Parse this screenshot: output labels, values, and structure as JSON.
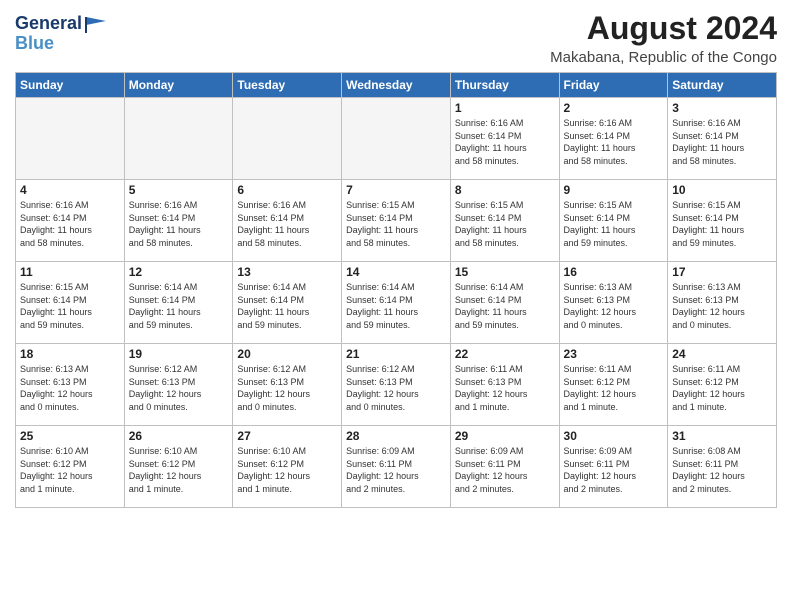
{
  "logo": {
    "line1": "General",
    "line2": "Blue"
  },
  "title": "August 2024",
  "subtitle": "Makabana, Republic of the Congo",
  "days_of_week": [
    "Sunday",
    "Monday",
    "Tuesday",
    "Wednesday",
    "Thursday",
    "Friday",
    "Saturday"
  ],
  "weeks": [
    [
      {
        "day": "",
        "info": ""
      },
      {
        "day": "",
        "info": ""
      },
      {
        "day": "",
        "info": ""
      },
      {
        "day": "",
        "info": ""
      },
      {
        "day": "1",
        "info": "Sunrise: 6:16 AM\nSunset: 6:14 PM\nDaylight: 11 hours\nand 58 minutes."
      },
      {
        "day": "2",
        "info": "Sunrise: 6:16 AM\nSunset: 6:14 PM\nDaylight: 11 hours\nand 58 minutes."
      },
      {
        "day": "3",
        "info": "Sunrise: 6:16 AM\nSunset: 6:14 PM\nDaylight: 11 hours\nand 58 minutes."
      }
    ],
    [
      {
        "day": "4",
        "info": "Sunrise: 6:16 AM\nSunset: 6:14 PM\nDaylight: 11 hours\nand 58 minutes."
      },
      {
        "day": "5",
        "info": "Sunrise: 6:16 AM\nSunset: 6:14 PM\nDaylight: 11 hours\nand 58 minutes."
      },
      {
        "day": "6",
        "info": "Sunrise: 6:16 AM\nSunset: 6:14 PM\nDaylight: 11 hours\nand 58 minutes."
      },
      {
        "day": "7",
        "info": "Sunrise: 6:15 AM\nSunset: 6:14 PM\nDaylight: 11 hours\nand 58 minutes."
      },
      {
        "day": "8",
        "info": "Sunrise: 6:15 AM\nSunset: 6:14 PM\nDaylight: 11 hours\nand 58 minutes."
      },
      {
        "day": "9",
        "info": "Sunrise: 6:15 AM\nSunset: 6:14 PM\nDaylight: 11 hours\nand 59 minutes."
      },
      {
        "day": "10",
        "info": "Sunrise: 6:15 AM\nSunset: 6:14 PM\nDaylight: 11 hours\nand 59 minutes."
      }
    ],
    [
      {
        "day": "11",
        "info": "Sunrise: 6:15 AM\nSunset: 6:14 PM\nDaylight: 11 hours\nand 59 minutes."
      },
      {
        "day": "12",
        "info": "Sunrise: 6:14 AM\nSunset: 6:14 PM\nDaylight: 11 hours\nand 59 minutes."
      },
      {
        "day": "13",
        "info": "Sunrise: 6:14 AM\nSunset: 6:14 PM\nDaylight: 11 hours\nand 59 minutes."
      },
      {
        "day": "14",
        "info": "Sunrise: 6:14 AM\nSunset: 6:14 PM\nDaylight: 11 hours\nand 59 minutes."
      },
      {
        "day": "15",
        "info": "Sunrise: 6:14 AM\nSunset: 6:14 PM\nDaylight: 11 hours\nand 59 minutes."
      },
      {
        "day": "16",
        "info": "Sunrise: 6:13 AM\nSunset: 6:13 PM\nDaylight: 12 hours\nand 0 minutes."
      },
      {
        "day": "17",
        "info": "Sunrise: 6:13 AM\nSunset: 6:13 PM\nDaylight: 12 hours\nand 0 minutes."
      }
    ],
    [
      {
        "day": "18",
        "info": "Sunrise: 6:13 AM\nSunset: 6:13 PM\nDaylight: 12 hours\nand 0 minutes."
      },
      {
        "day": "19",
        "info": "Sunrise: 6:12 AM\nSunset: 6:13 PM\nDaylight: 12 hours\nand 0 minutes."
      },
      {
        "day": "20",
        "info": "Sunrise: 6:12 AM\nSunset: 6:13 PM\nDaylight: 12 hours\nand 0 minutes."
      },
      {
        "day": "21",
        "info": "Sunrise: 6:12 AM\nSunset: 6:13 PM\nDaylight: 12 hours\nand 0 minutes."
      },
      {
        "day": "22",
        "info": "Sunrise: 6:11 AM\nSunset: 6:13 PM\nDaylight: 12 hours\nand 1 minute."
      },
      {
        "day": "23",
        "info": "Sunrise: 6:11 AM\nSunset: 6:12 PM\nDaylight: 12 hours\nand 1 minute."
      },
      {
        "day": "24",
        "info": "Sunrise: 6:11 AM\nSunset: 6:12 PM\nDaylight: 12 hours\nand 1 minute."
      }
    ],
    [
      {
        "day": "25",
        "info": "Sunrise: 6:10 AM\nSunset: 6:12 PM\nDaylight: 12 hours\nand 1 minute."
      },
      {
        "day": "26",
        "info": "Sunrise: 6:10 AM\nSunset: 6:12 PM\nDaylight: 12 hours\nand 1 minute."
      },
      {
        "day": "27",
        "info": "Sunrise: 6:10 AM\nSunset: 6:12 PM\nDaylight: 12 hours\nand 1 minute."
      },
      {
        "day": "28",
        "info": "Sunrise: 6:09 AM\nSunset: 6:11 PM\nDaylight: 12 hours\nand 2 minutes."
      },
      {
        "day": "29",
        "info": "Sunrise: 6:09 AM\nSunset: 6:11 PM\nDaylight: 12 hours\nand 2 minutes."
      },
      {
        "day": "30",
        "info": "Sunrise: 6:09 AM\nSunset: 6:11 PM\nDaylight: 12 hours\nand 2 minutes."
      },
      {
        "day": "31",
        "info": "Sunrise: 6:08 AM\nSunset: 6:11 PM\nDaylight: 12 hours\nand 2 minutes."
      }
    ]
  ]
}
